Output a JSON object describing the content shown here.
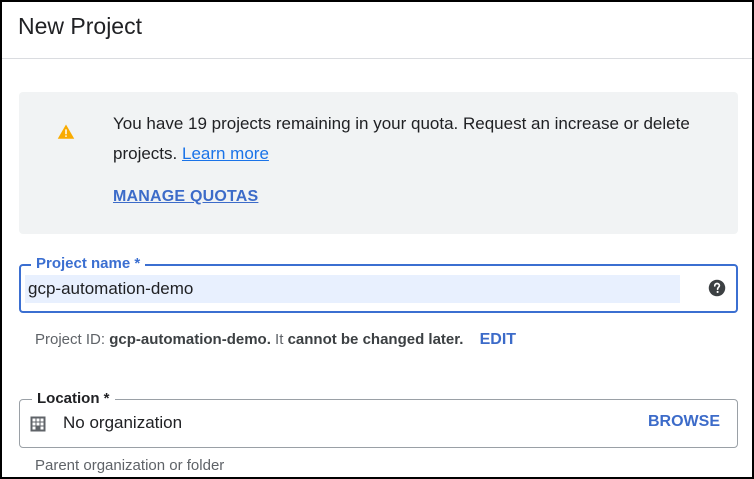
{
  "dialog": {
    "title": "New Project"
  },
  "alert": {
    "icon": "warning-icon",
    "message": "You have 19 projects remaining in your quota. Request an increase or delete projects.",
    "learn_more": "Learn more",
    "manage_quotas": "MANAGE QUOTAS"
  },
  "project_name": {
    "label": "Project name *",
    "value": "gcp-automation-demo",
    "help_icon": "help-icon"
  },
  "project_id": {
    "prefix": "Project ID:",
    "id": "gcp-automation-demo.",
    "middle": "It",
    "suffix": "cannot be changed later.",
    "edit": "EDIT"
  },
  "location": {
    "label": "Location *",
    "icon": "building-icon",
    "value": "No organization",
    "browse": "BROWSE",
    "helper": "Parent organization or folder"
  },
  "colors": {
    "accent": "#3b6fd1",
    "link": "#1a73e8",
    "warning": "#f9ab00",
    "alert_bg": "#f1f3f4",
    "input_fill": "#e8f0fe"
  }
}
